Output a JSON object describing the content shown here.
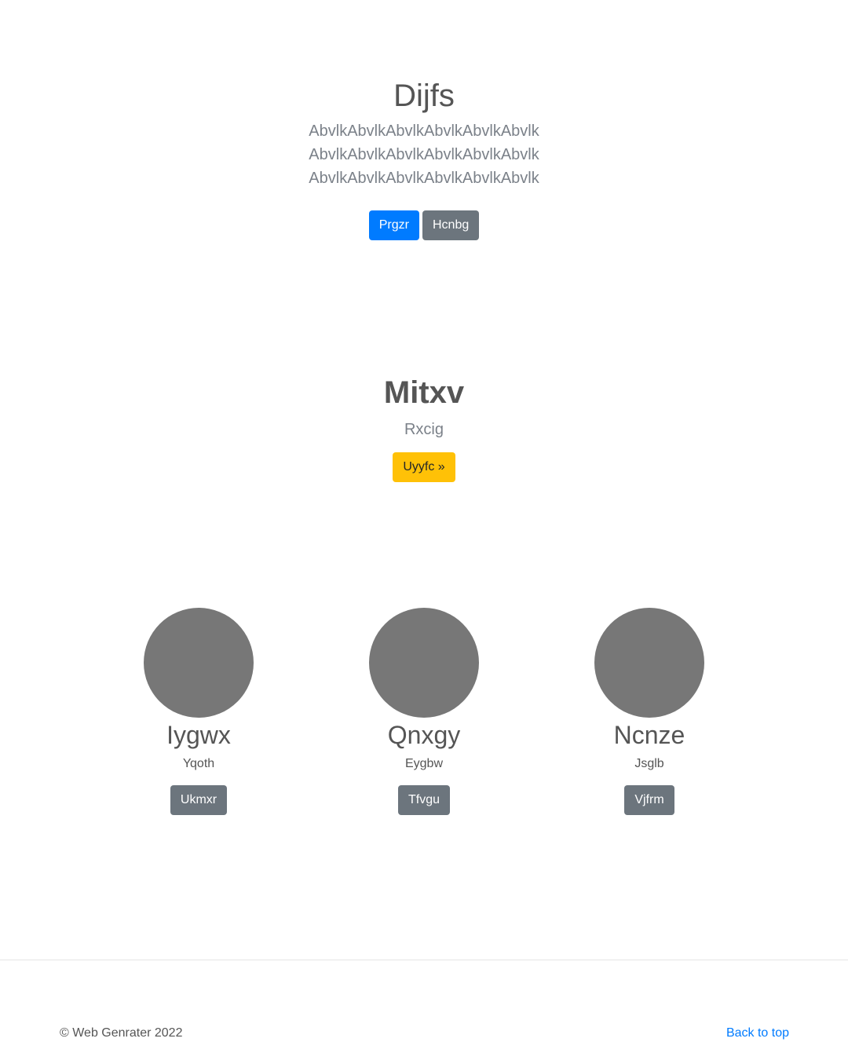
{
  "hero": {
    "title": "Dijfs",
    "lead": "AbvlkAbvlkAbvlkAbvlkAbvlkAbvlk AbvlkAbvlkAbvlkAbvlkAbvlkAbvlk AbvlkAbvlkAbvlkAbvlkAbvlkAbvlk",
    "primary_button": "Prgzr",
    "secondary_button": "Hcnbg"
  },
  "feature": {
    "title": "Mitxv",
    "subtitle": "Rxcig",
    "button": "Uyyfc »"
  },
  "cards": [
    {
      "name": "Iygwx",
      "desc": "Yqoth",
      "button": "Ukmxr"
    },
    {
      "name": "Qnxgy",
      "desc": "Eygbw",
      "button": "Tfvgu"
    },
    {
      "name": "Ncnze",
      "desc": "Jsglb",
      "button": "Vjfrm"
    }
  ],
  "footer": {
    "copyright": "© Web Genrater 2022",
    "back_to_top": "Back to top"
  },
  "colors": {
    "primary": "#007bff",
    "secondary": "#6c757d",
    "warning": "#ffc107",
    "avatar": "#777777"
  }
}
